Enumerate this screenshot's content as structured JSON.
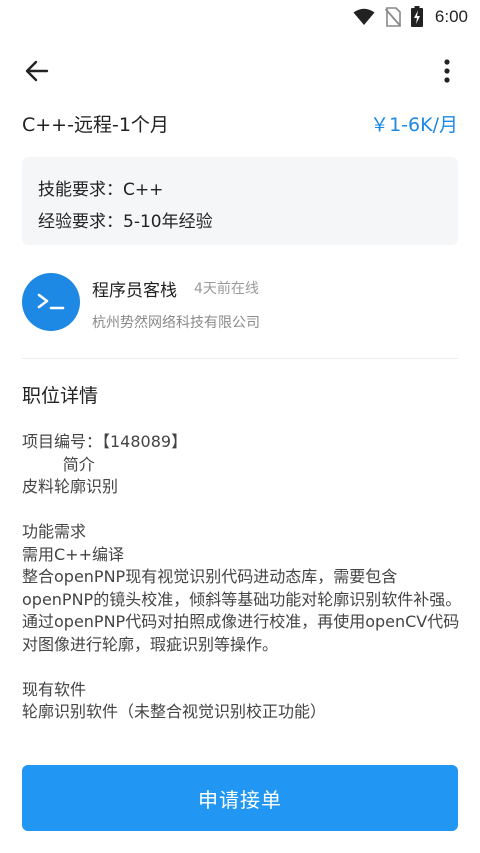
{
  "status_bar": {
    "time": "6:00",
    "icons": [
      "wifi-icon",
      "no-sim-icon",
      "battery-charging-icon"
    ]
  },
  "app_bar": {
    "back_icon": "arrow-left-icon",
    "more_icon": "more-vertical-icon"
  },
  "job": {
    "title": "C++-远程-1个月",
    "salary": "￥1-6K/月",
    "skill_requirement": "技能要求：C++",
    "experience_requirement": "经验要求：5-10年经验"
  },
  "publisher": {
    "avatar_symbol": ">_",
    "name": "程序员客栈",
    "online_status": "4天前在线",
    "company": "杭州势然网络科技有限公司"
  },
  "detail": {
    "section_title": "职位详情",
    "body": "项目编号：【148089】\n        简介\n皮料轮廓识别\n\n功能需求\n需用C++编译\n整合openPNP现有视觉识别代码进动态库，需要包含openPNP的镜头校准，倾斜等基础功能对轮廓识别软件补强。通过openPNP代码对拍照成像进行校准，再使用openCV代码对图像进行轮廓，瑕疵识别等操作。\n\n现有软件\n轮廓识别软件（未整合视觉识别校正功能）"
  },
  "apply_button": {
    "label": "申请接单"
  },
  "colors": {
    "accent": "#2196f3",
    "salary": "#1e88e5",
    "card_bg": "#f5f6f8"
  }
}
